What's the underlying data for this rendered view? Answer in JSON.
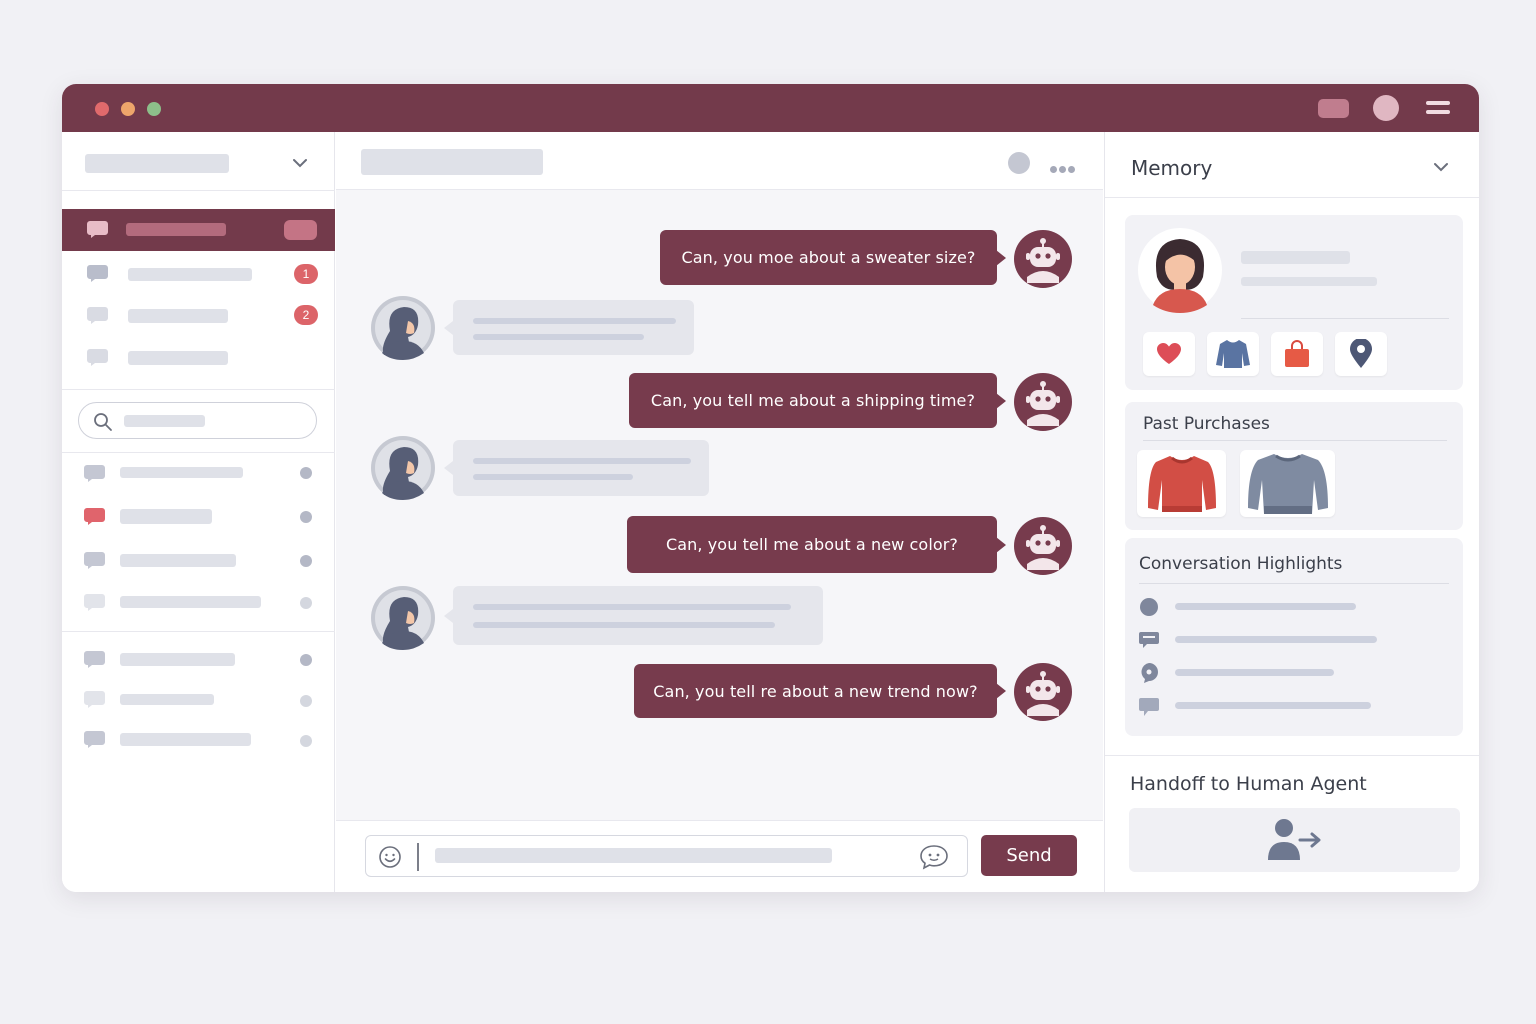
{
  "colors": {
    "brand": "#733a4b",
    "badge": "#dc6469",
    "background": "#f1f1f5",
    "placeholder": "#dfe1e8"
  },
  "titlebar": {
    "traffic_lights": [
      "#e06a6c",
      "#eda56b",
      "#8dbf8a"
    ],
    "icons": [
      "window-rect-icon",
      "profile-circle-icon",
      "hamburger-menu-icon"
    ]
  },
  "sidebar": {
    "header_icon": "chevron-down-icon",
    "top_items": [
      {
        "active": true,
        "badge": ""
      },
      {
        "active": false,
        "badge": "1"
      },
      {
        "active": false,
        "badge": "2"
      },
      {
        "active": false,
        "badge": ""
      }
    ],
    "search_icon": "search-icon",
    "list_items_count": 7
  },
  "chat": {
    "header_icons": [
      "status-dot-icon",
      "more-options-icon"
    ],
    "messages": [
      {
        "sender": "bot",
        "text": "Can, you moe about a sweater size?"
      },
      {
        "sender": "user"
      },
      {
        "sender": "bot",
        "text": "Can, you tell me about a shipping time?"
      },
      {
        "sender": "user"
      },
      {
        "sender": "bot",
        "text": "Can, you tell me about a new color?"
      },
      {
        "sender": "user"
      },
      {
        "sender": "bot",
        "text": "Can, you tell re about a new trend now?"
      }
    ],
    "composer": {
      "emoji_icon": "smiley-icon",
      "chat_icon": "chat-bubble-icon",
      "send_label": "Send"
    }
  },
  "memory": {
    "title": "Memory",
    "profile_icons": [
      "heart-icon",
      "sweater-icon",
      "shopping-bag-icon",
      "location-pin-icon"
    ],
    "past_purchases": {
      "title": "Past Purchases",
      "items": [
        "red-sweater-icon",
        "grey-sweater-icon"
      ]
    },
    "highlights": {
      "title": "Conversation Highlights",
      "row_icons": [
        "circle-icon",
        "message-icon",
        "pin-bubble-icon",
        "chat-icon"
      ]
    },
    "handoff": {
      "title": "Handoff to Human Agent",
      "icon": "handoff-person-arrow-icon"
    }
  }
}
